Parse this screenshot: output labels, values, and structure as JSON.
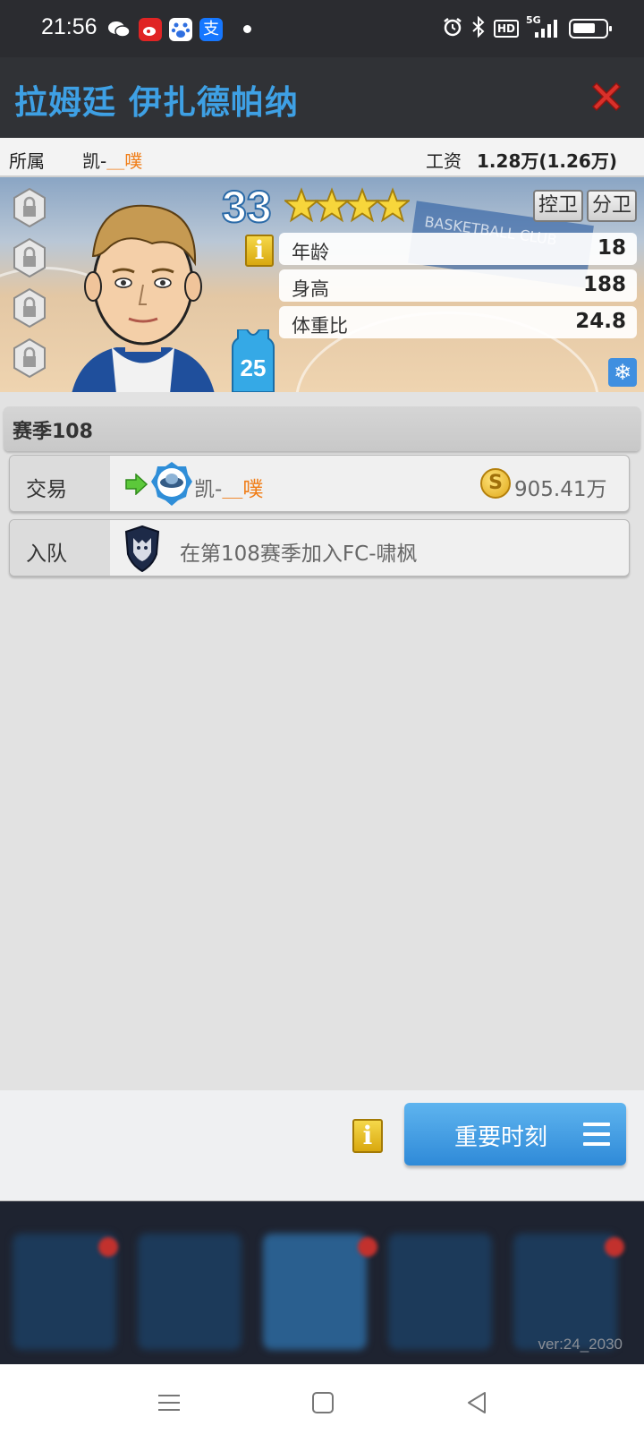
{
  "status_bar": {
    "time": "21:56",
    "icons": [
      "wechat-icon",
      "weibo-icon",
      "baidu-icon",
      "alipay-icon",
      "dot-icon",
      "alarm-icon",
      "bluetooth-icon",
      "hd-icon",
      "signal-5g-icon",
      "battery-icon"
    ],
    "hd_label": "HD",
    "network_label": "5G"
  },
  "header": {
    "title": "拉姆廷 伊扎德帕纳"
  },
  "info": {
    "owner_label": "所属",
    "owner_prefix": "凯-",
    "owner_highlight": "＿噗",
    "salary_label": "工资",
    "salary_value": "1.28万(1.26万)"
  },
  "player": {
    "rating": "33",
    "stars": 4,
    "positions": [
      "控卫",
      "分卫"
    ],
    "info_icon": "i",
    "jersey_number": "25",
    "stats": [
      {
        "label": "年龄",
        "value": "18"
      },
      {
        "label": "身高",
        "value": "188"
      },
      {
        "label": "体重比",
        "value": "24.8"
      }
    ],
    "banner_text": "BASKETBALL CLUB",
    "snowflake_icon": "❄"
  },
  "history": {
    "season_title": "赛季108",
    "rows": [
      {
        "kind": "交易",
        "name_prefix": "凯-",
        "name_highlight": "＿噗",
        "coin": "S",
        "amount": "905.41万"
      },
      {
        "kind": "入队",
        "text": "在第108赛季加入FC-啸枫"
      }
    ]
  },
  "actions": {
    "info_icon": "i",
    "key_moments_label": "重要时刻"
  },
  "footer": {
    "version": "ver:24_2030"
  },
  "colors": {
    "accent_blue": "#3ea0e4",
    "highlight_orange": "#f07d17",
    "close_red": "#d9302a"
  }
}
